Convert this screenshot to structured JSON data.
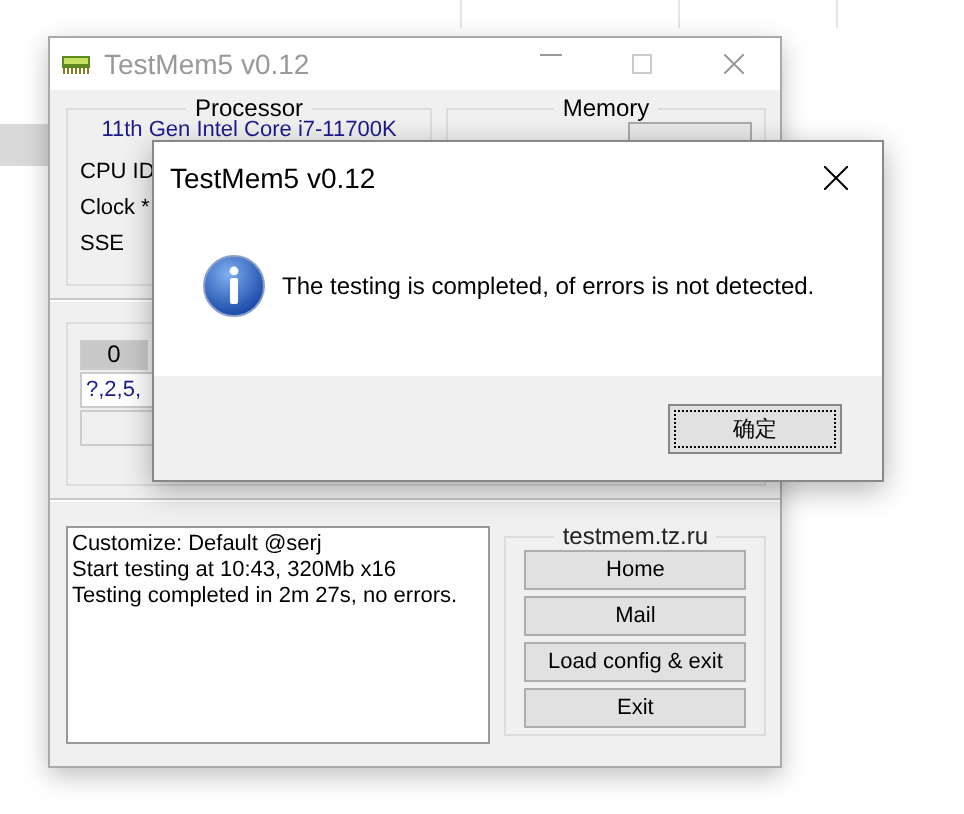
{
  "main_window": {
    "title": "TestMem5 v0.12",
    "processor": {
      "title": "Processor",
      "name": "11th Gen Intel Core i7-11700K",
      "labels": [
        "CPU ID",
        "Clock *",
        "SSE"
      ]
    },
    "memory": {
      "title": "Memory"
    },
    "test_tabs": [
      {
        "label": "0",
        "selected": true
      }
    ],
    "sequence": "?,2,5,",
    "log": [
      "Customize: Default @serj",
      "Start testing at 10:43, 320Mb x16",
      "Testing completed in 2m 27s, no errors."
    ],
    "links": {
      "title": "testmem.tz.ru",
      "buttons": [
        "Home",
        "Mail",
        "Load config & exit",
        "Exit"
      ]
    }
  },
  "dialog": {
    "title": "TestMem5 v0.12",
    "message": "The testing is completed, of errors is not detected.",
    "buttons": [
      "确定"
    ]
  }
}
